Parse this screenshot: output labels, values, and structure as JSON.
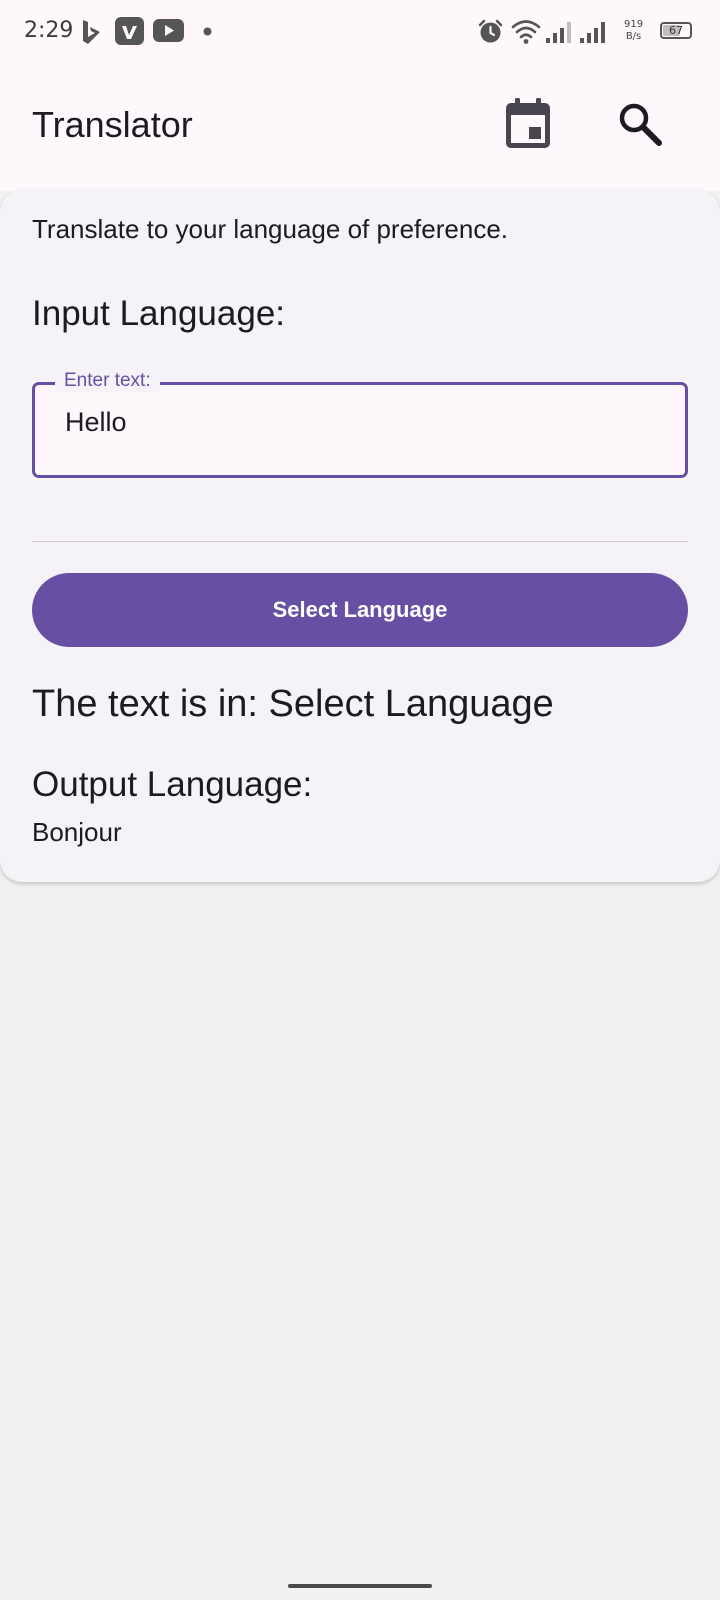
{
  "status_bar": {
    "time": "2:29",
    "net_speed_value": "919",
    "net_speed_unit": "B/s",
    "battery_level": "67",
    "battery_fraction": 0.67,
    "icons": [
      "bing-icon",
      "vimeo-icon",
      "youtube-icon",
      "notification-dot-icon",
      "alarm-icon",
      "wifi-icon",
      "signal-icon",
      "battery-icon"
    ]
  },
  "app_bar": {
    "title": "Translator",
    "actions": [
      "calendar-icon",
      "search-icon"
    ]
  },
  "card": {
    "intro": "Translate to your language of preference.",
    "input_label": "Input Language:",
    "input_field": {
      "label": "Enter text:",
      "value": "Hello"
    },
    "select_button_label": "Select Language",
    "detected_text": "The text is in: Select Language",
    "output_label": "Output Language:",
    "output_text": "Bonjour"
  },
  "colors": {
    "accent": "#6750a4",
    "surface": "#fef7fc",
    "card": "#f5f2f8",
    "background": "#f1f1f1",
    "on_surface": "#1c1b1f"
  }
}
